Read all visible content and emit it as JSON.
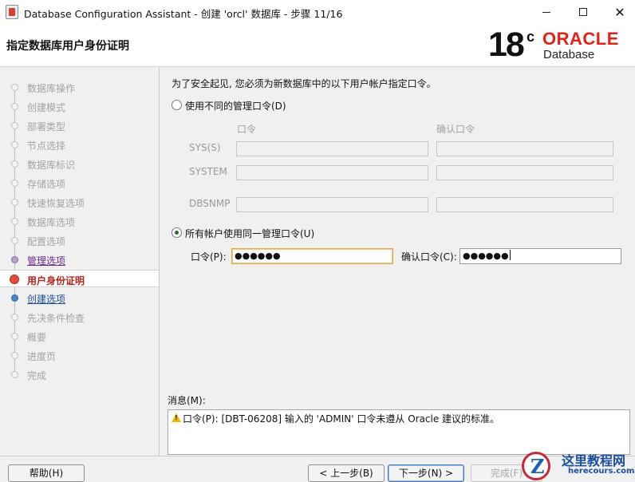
{
  "window": {
    "title": "Database Configuration Assistant - 创建 'orcl' 数据库 - 步骤 11/16"
  },
  "header": {
    "title": "指定数据库用户身份证明",
    "logo_version": "18",
    "logo_c": "c",
    "logo_brand": "ORACLE",
    "logo_product": "Database"
  },
  "nav": {
    "items": [
      {
        "label": "数据库操作",
        "state": "pending"
      },
      {
        "label": "创建模式",
        "state": "pending"
      },
      {
        "label": "部署类型",
        "state": "pending"
      },
      {
        "label": "节点选择",
        "state": "pending"
      },
      {
        "label": "数据库标识",
        "state": "pending"
      },
      {
        "label": "存储选项",
        "state": "pending"
      },
      {
        "label": "快速恢复选项",
        "state": "pending"
      },
      {
        "label": "数据库选项",
        "state": "pending"
      },
      {
        "label": "配置选项",
        "state": "pending"
      },
      {
        "label": "管理选项",
        "state": "done"
      },
      {
        "label": "用户身份证明",
        "state": "current"
      },
      {
        "label": "创建选项",
        "state": "next"
      },
      {
        "label": "先决条件检查",
        "state": "pending"
      },
      {
        "label": "概要",
        "state": "pending"
      },
      {
        "label": "进度页",
        "state": "pending"
      },
      {
        "label": "完成",
        "state": "pending"
      }
    ]
  },
  "main": {
    "intro": "为了安全起见, 您必须为新数据库中的以下用户帐户指定口令。",
    "option_separate": "使用不同的管理口令(D)",
    "col_password": "口令",
    "col_confirm": "确认口令",
    "accounts": [
      "SYS(S)",
      "SYSTEM",
      "DBSNMP"
    ],
    "option_same": "所有帐户使用同一管理口令(U)",
    "password_label": "口令(P):",
    "password_value": "●●●●●●",
    "confirm_label": "确认口令(C):",
    "confirm_value": "●●●●●●"
  },
  "messages": {
    "label": "消息(M):",
    "text": "口令(P): [DBT-06208] 输入的 'ADMIN' 口令未遵从 Oracle 建议的标准。"
  },
  "footer": {
    "help": "帮助(H)",
    "back": "< 上一步(B)",
    "next": "下一步(N) >",
    "finish": "完成(F)"
  },
  "watermark": {
    "cn": "这里教程网",
    "en": "herecours.com"
  }
}
